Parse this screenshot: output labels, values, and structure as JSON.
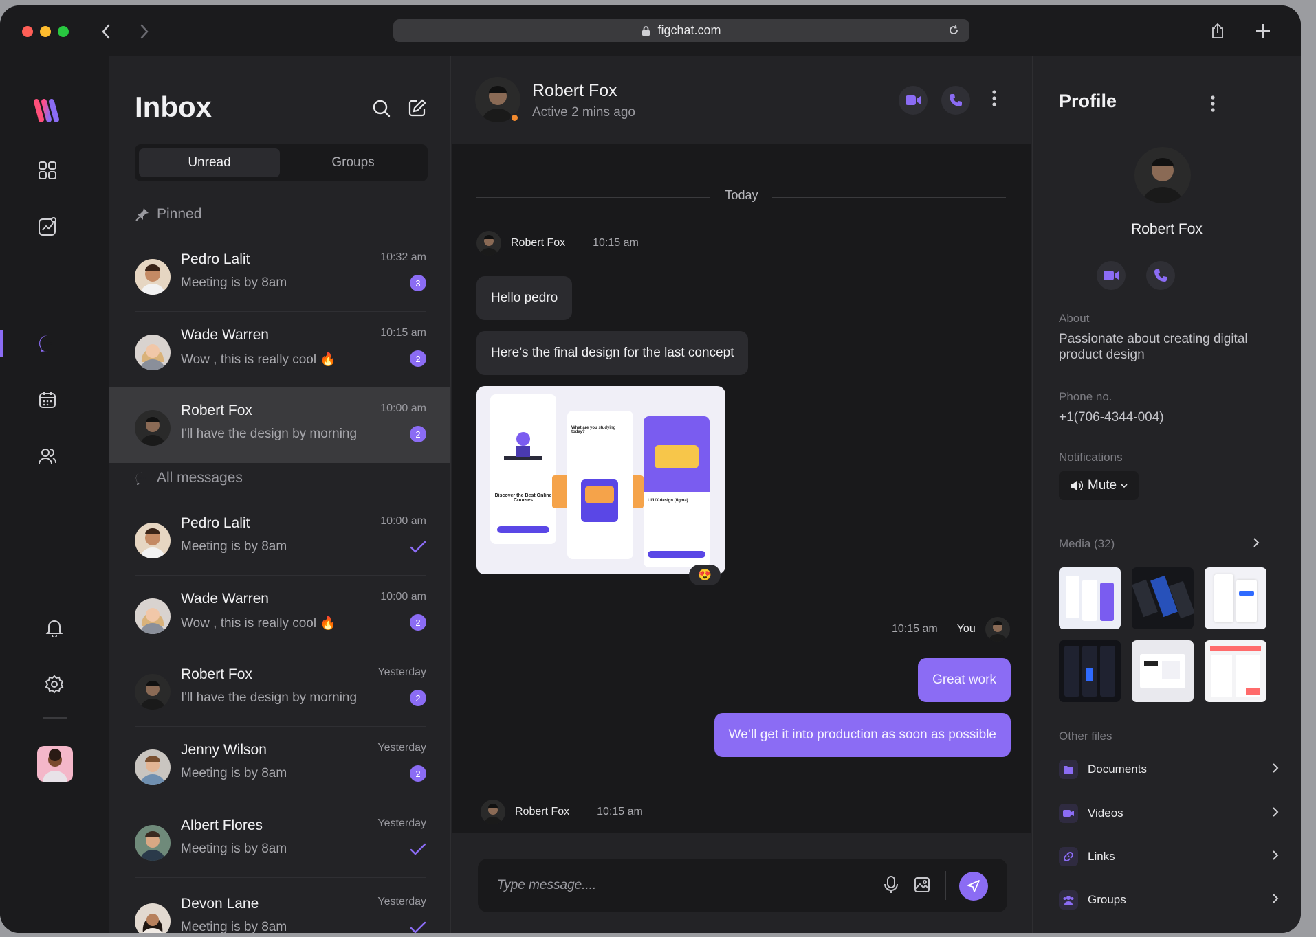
{
  "browser": {
    "url": "figchat.com"
  },
  "inbox": {
    "title": "Inbox",
    "tabs": [
      "Unread",
      "Groups"
    ],
    "pinned_label": "Pinned",
    "all_label": "All messages",
    "pinned": [
      {
        "name": "Pedro Lalit",
        "message": "Meeting is by 8am",
        "time": "10:32 am",
        "badge": "3"
      },
      {
        "name": "Wade Warren",
        "message": "Wow , this is really cool 🔥",
        "time": "10:15 am",
        "badge": "2"
      },
      {
        "name": "Robert Fox",
        "message": "I'll have the design by morning",
        "time": "10:00 am",
        "badge": "2"
      }
    ],
    "all": [
      {
        "name": "Pedro Lalit",
        "message": "Meeting is by 8am",
        "time": "10:00 am",
        "badge": ""
      },
      {
        "name": "Wade Warren",
        "message": "Wow , this is really cool 🔥",
        "time": "10:00 am",
        "badge": "2"
      },
      {
        "name": "Robert Fox",
        "message": "I'll have the design by morning",
        "time": "Yesterday",
        "badge": "2"
      },
      {
        "name": "Jenny Wilson",
        "message": "Meeting is by 8am",
        "time": "Yesterday",
        "badge": "2"
      },
      {
        "name": "Albert Flores",
        "message": "Meeting is by 8am",
        "time": "Yesterday",
        "badge": ""
      },
      {
        "name": "Devon Lane",
        "message": "Meeting is by 8am",
        "time": "Yesterday",
        "badge": ""
      }
    ]
  },
  "chat": {
    "name": "Robert Fox",
    "status": "Active 2 mins ago",
    "day": "Today",
    "sender1": {
      "name": "Robert Fox",
      "time": "10:15 am"
    },
    "msg1": "Hello pedro",
    "msg2": "Here’s the final design for the last concept",
    "image_texts": {
      "card1": "Discover the Best Online Courses",
      "card2": "What are you studying today?",
      "card3": "UI/UX design (figma)"
    },
    "reaction": "😍",
    "me": {
      "name": "You",
      "time": "10:15 am"
    },
    "out1": "Great work",
    "out2": "We’ll get it into production as soon as possible",
    "sender2": {
      "name": "Robert Fox",
      "time": "10:15 am"
    },
    "placeholder": "Type message...."
  },
  "profile": {
    "title": "Profile",
    "name": "Robert Fox",
    "about_label": "About",
    "about": "Passionate about creating digital product design",
    "phone_label": "Phone no.",
    "phone": "+1(706-4344-004)",
    "notif_label": "Notifications",
    "notif_value": "Mute",
    "media_label": "Media (32)",
    "other_label": "Other files",
    "files": [
      "Documents",
      "Videos",
      "Links",
      "Groups"
    ]
  },
  "colors": {
    "accent": "#8b6cf4",
    "bg": "#232326",
    "chat_bg": "#19191b",
    "online": "#f28a2e"
  }
}
